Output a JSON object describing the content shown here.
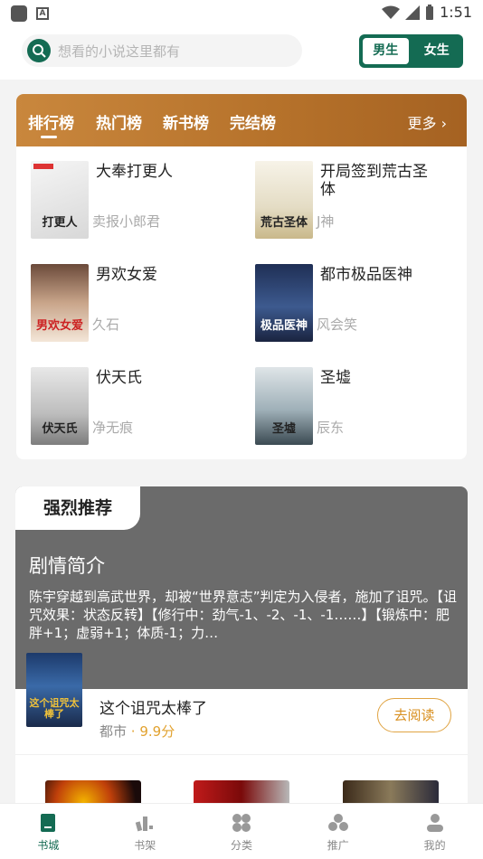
{
  "status_bar": {
    "time": "1:51"
  },
  "search": {
    "placeholder": "想看的小说这里都有"
  },
  "gender": {
    "male": "男生",
    "female": "女生"
  },
  "rank": {
    "tabs": [
      "排行榜",
      "热门榜",
      "新书榜",
      "完结榜"
    ],
    "more": "更多",
    "books": [
      {
        "title": "大奉打更人",
        "author": "卖报小郎君",
        "cover_text": "打更人"
      },
      {
        "title": "开局签到荒古圣体",
        "author": "J神",
        "cover_text": "荒古圣体"
      },
      {
        "title": "男欢女爱",
        "author": "久石",
        "cover_text": "男欢女爱"
      },
      {
        "title": "都市极品医神",
        "author": "风会笑",
        "cover_text": "极品医神"
      },
      {
        "title": "伏天氏",
        "author": "净无痕",
        "cover_text": "伏天氏"
      },
      {
        "title": "圣墟",
        "author": "辰东",
        "cover_text": "圣墟"
      }
    ]
  },
  "recommend": {
    "tag": "强烈推荐",
    "subtitle": "剧情简介",
    "description": "陈宇穿越到高武世界，却被“世界意志”判定为入侵者，施加了诅咒。【诅咒效果：状态反转】【修行中：劲气-1、-2、-1、-1……】【锻炼中：肥胖+1；虚弱+1；体质-1；力…",
    "book_title": "这个诅咒太棒了",
    "category": "都市",
    "score": "· 9.9分",
    "read_button": "去阅读",
    "cover_text": "这个诅咒太棒了"
  },
  "nav": [
    {
      "label": "书城"
    },
    {
      "label": "书架"
    },
    {
      "label": "分类"
    },
    {
      "label": "推广"
    },
    {
      "label": "我的"
    }
  ]
}
